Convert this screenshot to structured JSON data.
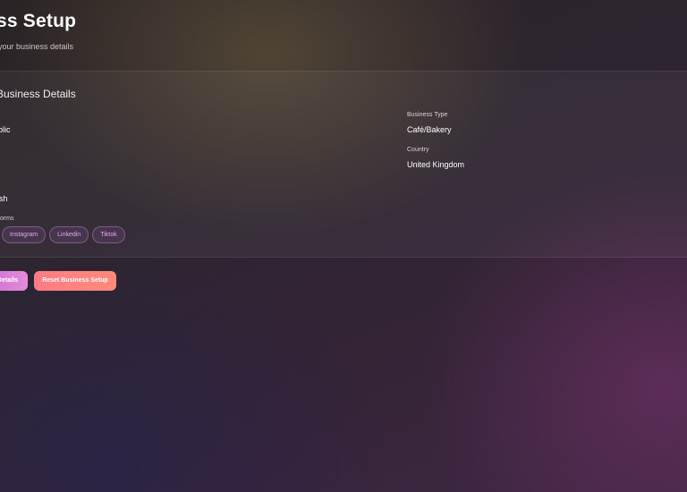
{
  "page": {
    "title": "ss Setup",
    "subtitle": "your business details"
  },
  "details": {
    "section_title": "Business Details",
    "fields": [
      {
        "label": "",
        "value": "blic"
      },
      {
        "label": "Business Type",
        "value": "Café/Bakery"
      },
      {
        "label": "Country",
        "value": "United Kingdom"
      },
      {
        "label": "",
        "value": "sh"
      }
    ],
    "platforms_label": "forms",
    "platforms": [
      "Instagram",
      "Linkedin",
      "Tiktok"
    ]
  },
  "actions": {
    "save_label": "Details",
    "reset_label": "Reset Business Setup"
  }
}
